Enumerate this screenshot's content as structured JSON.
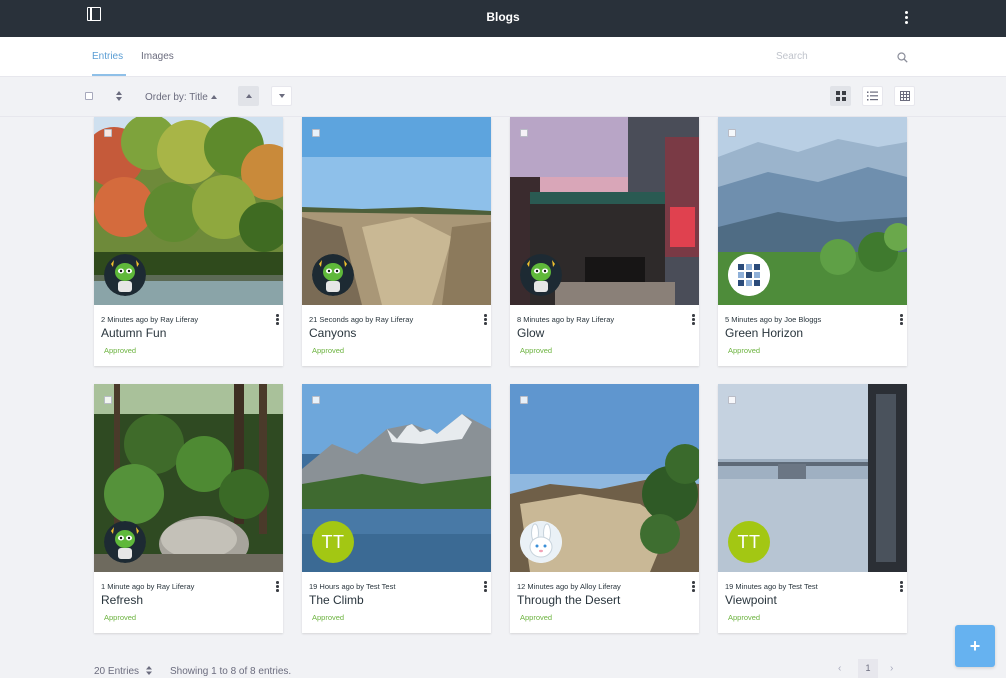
{
  "app": {
    "title": "Blogs"
  },
  "nav": {
    "tabs": [
      {
        "label": "Entries",
        "active": true
      },
      {
        "label": "Images",
        "active": false
      }
    ],
    "search_placeholder": "Search"
  },
  "toolbar": {
    "order_by_label": "Order by: Title"
  },
  "entries": [
    {
      "meta": "2 Minutes ago by Ray Liferay",
      "title": "Autumn Fun",
      "status": "Approved",
      "avatar": "alien"
    },
    {
      "meta": "21 Seconds ago by Ray Liferay",
      "title": "Canyons",
      "status": "Approved",
      "avatar": "alien"
    },
    {
      "meta": "8 Minutes ago by Ray Liferay",
      "title": "Glow",
      "status": "Approved",
      "avatar": "alien"
    },
    {
      "meta": "5 Minutes ago by Joe Bloggs",
      "title": "Green Horizon",
      "status": "Approved",
      "avatar": "pattern"
    },
    {
      "meta": "1 Minute ago by Ray Liferay",
      "title": "Refresh",
      "status": "Approved",
      "avatar": "alien"
    },
    {
      "meta": "19 Hours ago by Test Test",
      "title": "The Climb",
      "status": "Approved",
      "avatar": "initials",
      "initials": "TT"
    },
    {
      "meta": "12 Minutes ago by Alloy Liferay",
      "title": "Through the Desert",
      "status": "Approved",
      "avatar": "rabbit"
    },
    {
      "meta": "19 Minutes ago by Test Test",
      "title": "Viewpoint",
      "status": "Approved",
      "avatar": "initials",
      "initials": "TT"
    }
  ],
  "footer": {
    "entries_per_page": "20 Entries",
    "showing": "Showing 1 to 8 of 8 entries.",
    "current_page": "1"
  },
  "colors": {
    "topbar": "#29313a",
    "accent": "#5a9dd4",
    "approved": "#6cb33f",
    "fab": "#66b2f0",
    "initials_avatar": "#a3c713"
  },
  "icons": [
    "sidebar-toggle-icon",
    "kebab-menu-icon",
    "search-icon",
    "sort-arrows-icon",
    "sort-ascending-icon",
    "sort-descending-icon",
    "cards-view-icon",
    "list-view-icon",
    "table-view-icon",
    "chevron-left-icon",
    "chevron-right-icon",
    "plus-icon"
  ]
}
